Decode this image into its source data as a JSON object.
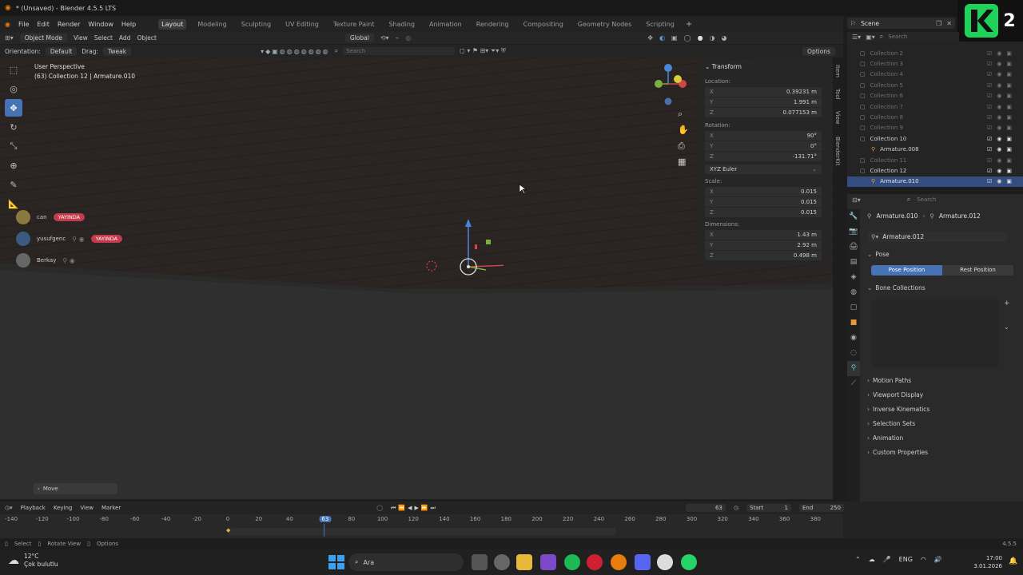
{
  "window": {
    "title": "* (Unsaved) - Blender 4.5.5 LTS"
  },
  "menu": [
    "File",
    "Edit",
    "Render",
    "Window",
    "Help"
  ],
  "workspaces": [
    "Layout",
    "Modeling",
    "Sculpting",
    "UV Editing",
    "Texture Paint",
    "Shading",
    "Animation",
    "Rendering",
    "Compositing",
    "Geometry Nodes",
    "Scripting"
  ],
  "active_workspace": "Layout",
  "scene": {
    "label": "Scene"
  },
  "badge": {
    "text": "2"
  },
  "header": {
    "mode": "Object Mode",
    "view": "View",
    "select": "Select",
    "add": "Add",
    "object": "Object",
    "transform_space": "Global"
  },
  "header2": {
    "orientation_label": "Orientation:",
    "orientation": "Default",
    "drag_label": "Drag:",
    "drag": "Tweak",
    "search_placeholder": "Search",
    "options": "Options"
  },
  "viewport": {
    "line1": "User Perspective",
    "line2": "(63) Collection 12 | Armature.010"
  },
  "users": [
    {
      "name": "can",
      "tag": "YAYINDA"
    },
    {
      "name": "yusufgenc",
      "tag": "YAYINDA"
    },
    {
      "name": "Berkay",
      "tag": ""
    }
  ],
  "npanel": {
    "title": "Transform",
    "location_label": "Location:",
    "location": [
      {
        "axis": "X",
        "val": "0.39231 m"
      },
      {
        "axis": "Y",
        "val": "1.991 m"
      },
      {
        "axis": "Z",
        "val": "0.077153 m"
      }
    ],
    "rotation_label": "Rotation:",
    "rotation": [
      {
        "axis": "X",
        "val": "90°"
      },
      {
        "axis": "Y",
        "val": "0°"
      },
      {
        "axis": "Z",
        "val": "-131.71°"
      }
    ],
    "rotation_mode": "XYZ Euler",
    "scale_label": "Scale:",
    "scale": [
      {
        "axis": "X",
        "val": "0.015"
      },
      {
        "axis": "Y",
        "val": "0.015"
      },
      {
        "axis": "Z",
        "val": "0.015"
      }
    ],
    "dimensions_label": "Dimensions:",
    "dimensions": [
      {
        "axis": "X",
        "val": "1.43 m"
      },
      {
        "axis": "Y",
        "val": "2.92 m"
      },
      {
        "axis": "Z",
        "val": "0.498 m"
      }
    ]
  },
  "ntabs": [
    "Item",
    "Tool",
    "View",
    "BlenderKit"
  ],
  "operator_panel": "Move",
  "outliner": {
    "search_placeholder": "Search",
    "rows": [
      {
        "name": "Collection 2",
        "state": "dim"
      },
      {
        "name": "Collection 3",
        "state": "dim"
      },
      {
        "name": "Collection 4",
        "state": "dim"
      },
      {
        "name": "Collection 5",
        "state": "dim"
      },
      {
        "name": "Collection 6",
        "state": "dim"
      },
      {
        "name": "Collection 7",
        "state": "dim"
      },
      {
        "name": "Collection 8",
        "state": "dim"
      },
      {
        "name": "Collection 9",
        "state": "dim"
      },
      {
        "name": "Collection 10",
        "state": "vis"
      },
      {
        "name": "Armature.008",
        "state": "vis"
      },
      {
        "name": "Collection 11",
        "state": "dim"
      },
      {
        "name": "Collection 12",
        "state": "vis"
      },
      {
        "name": "Armature.010",
        "state": "sel"
      }
    ]
  },
  "properties": {
    "search_placeholder": "Search",
    "breadcrumb_obj": "Armature.010",
    "breadcrumb_data": "Armature.012",
    "datablock": "Armature.012",
    "pose_section": "Pose",
    "pose_position": "Pose Position",
    "rest_position": "Rest Position",
    "bone_collections": "Bone Collections",
    "sections": [
      "Motion Paths",
      "Viewport Display",
      "Inverse Kinematics",
      "Selection Sets",
      "Animation",
      "Custom Properties"
    ]
  },
  "timeline": {
    "menus": [
      "Playback",
      "Keying",
      "View",
      "Marker"
    ],
    "current_frame": "63",
    "start_label": "Start",
    "start": "1",
    "end_label": "End",
    "end": "250",
    "ticks": [
      "-140",
      "-120",
      "-100",
      "-80",
      "-60",
      "-40",
      "-20",
      "0",
      "20",
      "40",
      "63",
      "80",
      "100",
      "120",
      "140",
      "160",
      "180",
      "200",
      "220",
      "240",
      "260",
      "280",
      "300",
      "320",
      "340",
      "360",
      "380"
    ]
  },
  "status": {
    "select": "Select",
    "rotate": "Rotate View",
    "options": "Options",
    "version": "4.5.5"
  },
  "taskbar": {
    "weather_temp": "12°C",
    "weather_desc": "Çok bulutlu",
    "search": "Ara",
    "lang": "ENG",
    "time": "17:00",
    "date": "3.01.2026"
  },
  "colors": {
    "accent": "#4772b3",
    "live": "#c63a4b",
    "logo_bg": "#111111",
    "logo_fg": "#1fd35a"
  }
}
